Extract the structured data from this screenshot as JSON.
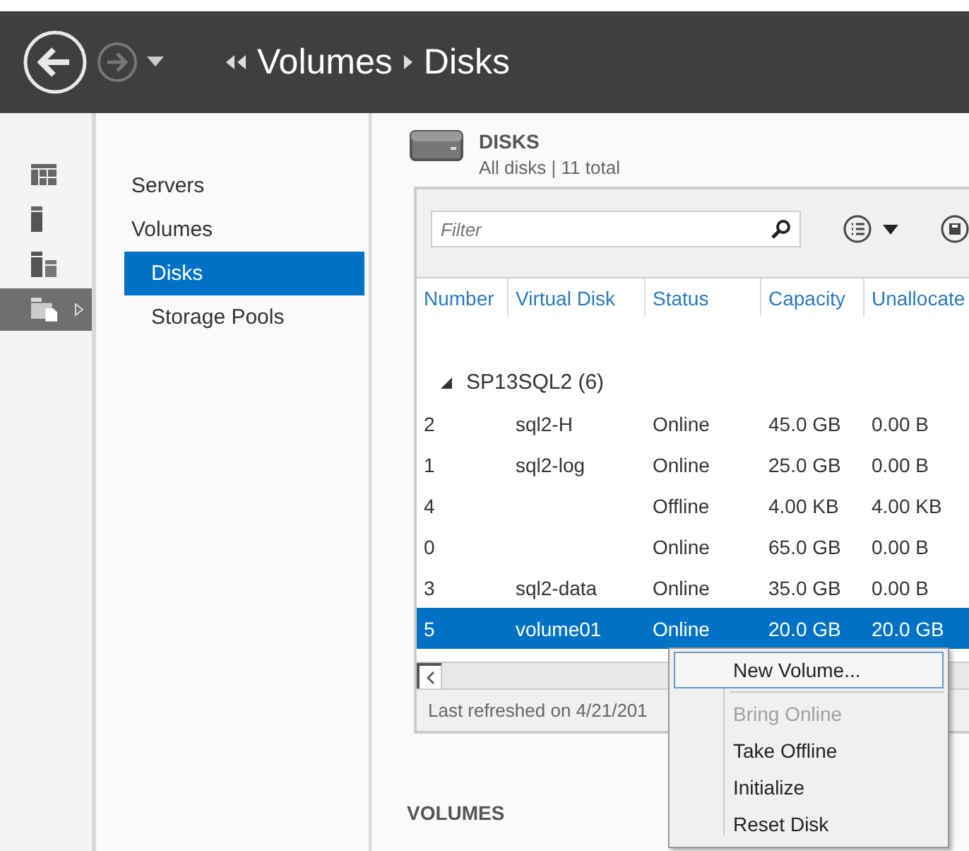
{
  "header": {
    "back_enabled": true,
    "forward_enabled": false,
    "breadcrumb": [
      "Volumes",
      "Disks"
    ]
  },
  "rail": [
    {
      "kind": "table",
      "selected": false
    },
    {
      "kind": "server",
      "selected": false
    },
    {
      "kind": "volumes",
      "selected": false
    },
    {
      "kind": "disks",
      "selected": true
    }
  ],
  "nav": [
    {
      "label": "Servers",
      "selected": false
    },
    {
      "label": "Volumes",
      "selected": false,
      "children": [
        {
          "label": "Disks",
          "selected": true
        },
        {
          "label": "Storage Pools",
          "selected": false
        }
      ]
    }
  ],
  "disks": {
    "title": "DISKS",
    "subtitle": "All disks | 11 total",
    "filter": {
      "placeholder": "Filter"
    },
    "columns": [
      "Number",
      "Virtual Disk",
      "Status",
      "Capacity",
      "Unallocate"
    ],
    "group": {
      "label": "SP13SQL2 (6)",
      "expanded": true
    },
    "rows": [
      {
        "cells": [
          "2",
          "sql2-H",
          "Online",
          "45.0 GB",
          "0.00 B"
        ],
        "selected": false
      },
      {
        "cells": [
          "1",
          "sql2-log",
          "Online",
          "25.0 GB",
          "0.00 B"
        ],
        "selected": false
      },
      {
        "cells": [
          "4",
          "",
          "Offline",
          "4.00 KB",
          "4.00 KB"
        ],
        "selected": false
      },
      {
        "cells": [
          "0",
          "",
          "Online",
          "65.0 GB",
          "0.00 B"
        ],
        "selected": false
      },
      {
        "cells": [
          "3",
          "sql2-data",
          "Online",
          "35.0 GB",
          "0.00 B"
        ],
        "selected": false
      },
      {
        "cells": [
          "5",
          "volume01",
          "Online",
          "20.0 GB",
          "20.0 GB"
        ],
        "selected": true
      }
    ],
    "status": "Last refreshed on 4/21/201"
  },
  "volumes": {
    "title": "VOLUMES"
  },
  "context_menu": [
    {
      "label": "New Volume...",
      "disabled": false,
      "selected": true
    },
    {
      "kind": "separator"
    },
    {
      "label": "Bring Online",
      "disabled": true,
      "selected": false
    },
    {
      "label": "Take Offline",
      "disabled": false,
      "selected": false
    },
    {
      "label": "Initialize",
      "disabled": false,
      "selected": false
    },
    {
      "label": "Reset Disk",
      "disabled": false,
      "selected": false
    }
  ]
}
